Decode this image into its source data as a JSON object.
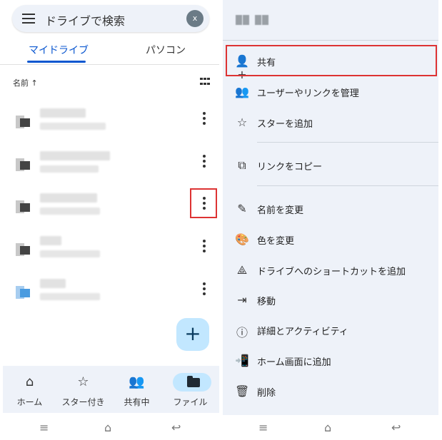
{
  "left": {
    "search_placeholder": "ドライブで検索",
    "avatar_letter": "x",
    "tabs": [
      "マイドライブ",
      "パソコン"
    ],
    "sort_label": "名前 ↑",
    "fab_label": "+",
    "bottom_nav": [
      {
        "label": "ホーム",
        "icon": "home-icon",
        "glyph": "⌂"
      },
      {
        "label": "スター付き",
        "icon": "star-icon",
        "glyph": "☆"
      },
      {
        "label": "共有中",
        "icon": "people-icon",
        "glyph": "👥"
      },
      {
        "label": "ファイル",
        "icon": "folder-icon",
        "glyph": ""
      }
    ]
  },
  "system_nav": {
    "menu": "≡",
    "home": "⌂",
    "back": "↩"
  },
  "right": {
    "actions": [
      {
        "label": "共有",
        "icon": "person-add-icon",
        "glyph": "👤+"
      },
      {
        "label": "ユーザーやリンクを管理",
        "icon": "people-icon",
        "glyph": "👥"
      },
      {
        "label": "スターを追加",
        "icon": "star-icon",
        "glyph": "☆"
      },
      {
        "label": "リンクをコピー",
        "icon": "copy-icon",
        "glyph": "⧉"
      },
      {
        "label": "名前を変更",
        "icon": "pencil-icon",
        "glyph": "✎"
      },
      {
        "label": "色を変更",
        "icon": "palette-icon",
        "glyph": "🎨"
      },
      {
        "label": "ドライブへのショートカットを追加",
        "icon": "shortcut-icon",
        "glyph": "⟁"
      },
      {
        "label": "移動",
        "icon": "move-icon",
        "glyph": "⇥"
      },
      {
        "label": "詳細とアクティビティ",
        "icon": "info-icon",
        "glyph": "ⓘ"
      },
      {
        "label": "ホーム画面に追加",
        "icon": "add-to-home-icon",
        "glyph": "📲"
      },
      {
        "label": "削除",
        "icon": "trash-icon",
        "glyph": "🗑"
      }
    ]
  },
  "colors": {
    "accent": "#0b57d0",
    "highlight": "#dd3333",
    "sheet_bg": "#eef2f9",
    "fab_bg": "#c2e7ff"
  }
}
